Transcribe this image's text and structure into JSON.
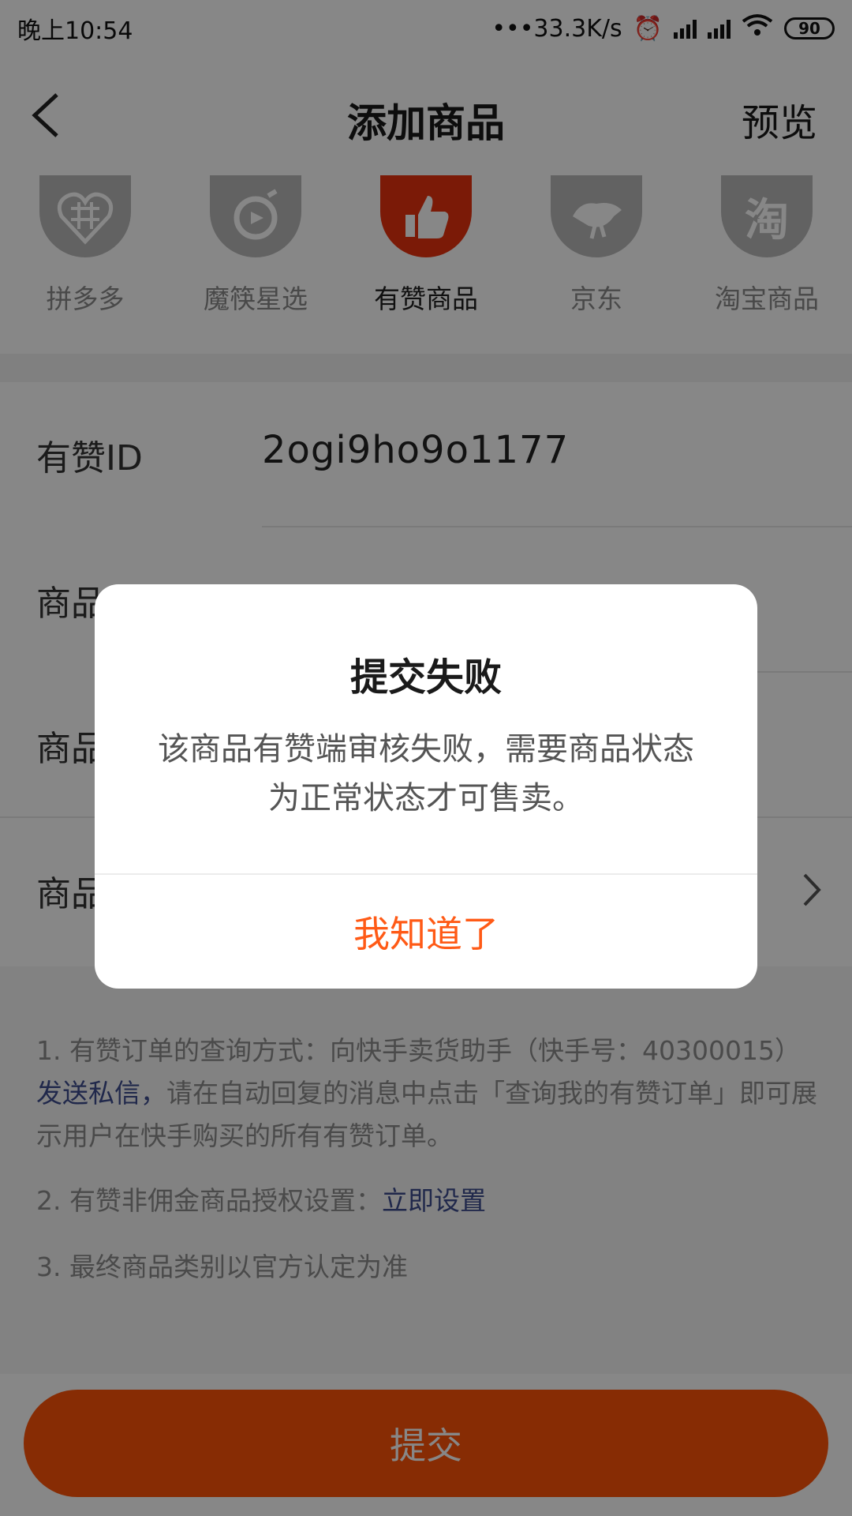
{
  "status": {
    "time": "晚上10:54",
    "network_speed": "•••33.3K/s",
    "battery": "90"
  },
  "nav": {
    "title": "添加商品",
    "preview_label": "预览"
  },
  "sources": [
    {
      "label": "拼多多",
      "icon": "pinduoduo-icon",
      "active": false
    },
    {
      "label": "魔筷星选",
      "icon": "mokuai-icon",
      "active": false
    },
    {
      "label": "有赞商品",
      "icon": "thumbs-up-icon",
      "active": true
    },
    {
      "label": "京东",
      "icon": "jd-dog-icon",
      "active": false
    },
    {
      "label": "淘宝商品",
      "icon": "taobao-icon",
      "icon_text": "淘",
      "active": false
    }
  ],
  "form": {
    "youzan_id_label": "有赞ID",
    "youzan_id_value": "2ogi9ho9o1177",
    "row2_label": "商品",
    "row3_label": "商品",
    "row4_label": "商品"
  },
  "notes": {
    "note1_prefix": "1. 有赞订单的查询方式：向快手卖货助手（快手号：40300015）",
    "note1_link": "发送私信，",
    "note1_suffix": "请在自动回复的消息中点击「查询我的有赞订单」即可展示用户在快手购买的所有有赞订单。",
    "note2_prefix": "2. 有赞非佣金商品授权设置：",
    "note2_link": "立即设置",
    "note3": "3. 最终商品类别以官方认定为准"
  },
  "submit_label": "提交",
  "dialog": {
    "title": "提交失败",
    "message": "该商品有赞端审核失败，需要商品状态为正常状态才可售卖。",
    "confirm_label": "我知道了"
  },
  "colors": {
    "accent": "#ff5409",
    "active_icon": "#e8320e",
    "link": "#3d4c8e"
  }
}
